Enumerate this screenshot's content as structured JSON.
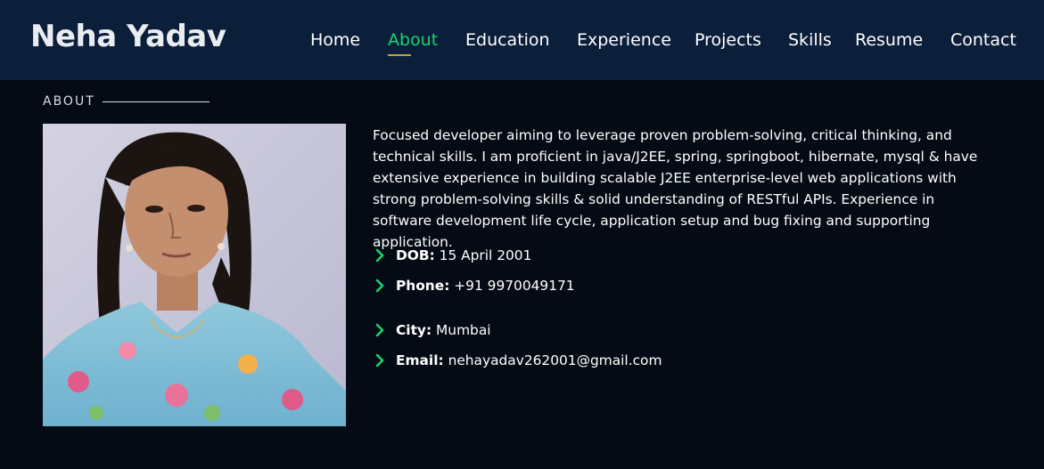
{
  "header": {
    "logo": "Neha Yadav",
    "nav": [
      {
        "label": "Home",
        "active": false
      },
      {
        "label": "About",
        "active": true
      },
      {
        "label": "Education",
        "active": false
      },
      {
        "label": "Experience",
        "active": false
      },
      {
        "label": "Projects",
        "active": false
      },
      {
        "label": "Skills",
        "active": false
      },
      {
        "label": "Resume",
        "active": false
      },
      {
        "label": "Contact",
        "active": false
      }
    ]
  },
  "about": {
    "section_title": "ABOUT",
    "description": "Focused developer aiming to leverage proven problem-solving, critical thinking, and technical skills. I am proficient in java/J2EE, spring, springboot, hibernate, mysql & have extensive experience in building scalable J2EE enterprise-level web applications with strong problem-solving skills & solid understanding of RESTful APIs. Experience in software development life cycle, application setup and bug fixing and supporting application.",
    "info": [
      {
        "label": "DOB:",
        "value": "15 April 2001"
      },
      {
        "label": "Phone:",
        "value": "+91 9970049171"
      },
      {
        "label": "City:",
        "value": "Mumbai"
      },
      {
        "label": "Email:",
        "value": "nehayadav262001@gmail.com"
      }
    ]
  },
  "colors": {
    "accent": "#18d26e",
    "header_bg": "#0b1e3a",
    "page_bg": "#040b14",
    "nav_underline": "#c9a13a"
  },
  "icons": {
    "list_bullet": "chevron-right-icon"
  }
}
